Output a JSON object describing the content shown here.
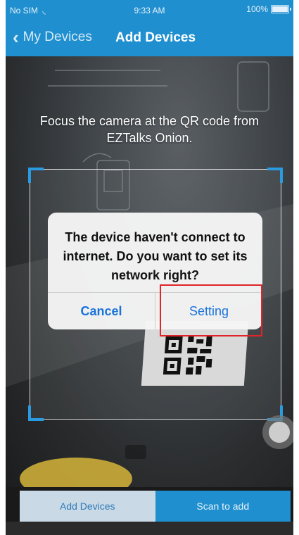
{
  "status_bar": {
    "carrier": "No SIM",
    "wifi_icon": "wifi-icon",
    "time": "9:33 AM",
    "battery": "100%"
  },
  "nav": {
    "back_label": "My Devices",
    "title": "Add Devices"
  },
  "camera": {
    "instruction": "Focus the camera at the QR code from EZTalks Onion."
  },
  "dialog": {
    "message": "The device haven't connect to internet. Do you want to set its network right?",
    "cancel_label": "Cancel",
    "setting_label": "Setting"
  },
  "tabs": [
    {
      "label": "Add Devices",
      "active": true
    },
    {
      "label": "Scan to add",
      "active": false
    }
  ],
  "colors": {
    "header": "#1f8fcf",
    "dialog_button": "#1a73d9",
    "highlight": "#e0242a",
    "scan_corner": "#2a9be0"
  }
}
